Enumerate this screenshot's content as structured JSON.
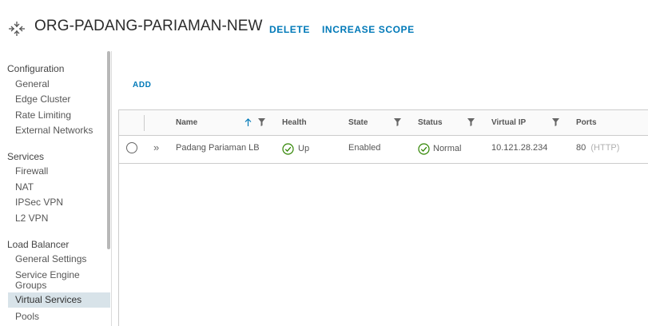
{
  "header": {
    "title": "ORG-PADANG-PARIAMAN-NEW",
    "delete_label": "DELETE",
    "increase_scope_label": "INCREASE SCOPE",
    "icon": "edge-gateway-icon"
  },
  "sidebar": {
    "groups": [
      {
        "title": "Configuration",
        "items": [
          "General",
          "Edge Cluster",
          "Rate Limiting",
          "External Networks"
        ]
      },
      {
        "title": "Services",
        "items": [
          "Firewall",
          "NAT",
          "IPSec VPN",
          "L2 VPN"
        ]
      },
      {
        "title": "Load Balancer",
        "items": [
          "General Settings",
          "Service Engine Groups",
          "Virtual Services",
          "Pools"
        ]
      }
    ],
    "active_item": "Virtual Services"
  },
  "toolbar": {
    "add_label": "ADD"
  },
  "grid": {
    "columns": [
      "Name",
      "Health",
      "State",
      "Status",
      "Virtual IP",
      "Ports"
    ],
    "sorted_column": "Name",
    "rows": [
      {
        "name": "Padang Pariaman LB",
        "health": "Up",
        "state": "Enabled",
        "status": "Normal",
        "virtual_ip": "10.121.28.234",
        "port": "80",
        "protocol": "(HTTP)"
      }
    ]
  },
  "colors": {
    "link": "#0079b8",
    "success": "#2f8400",
    "active_bg": "#d8e3e9"
  }
}
